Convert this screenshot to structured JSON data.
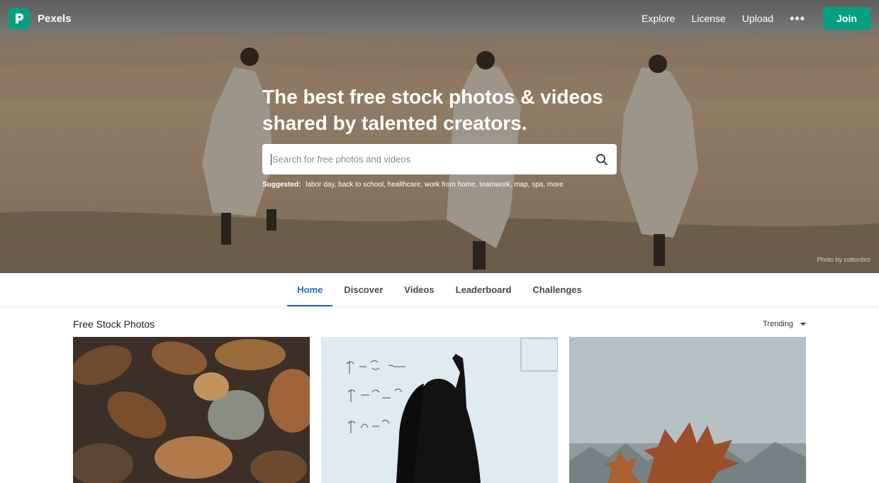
{
  "brand": {
    "name": "Pexels",
    "color": "#05a081"
  },
  "nav": {
    "explore": "Explore",
    "license": "License",
    "upload": "Upload",
    "more_icon": "ellipsis-icon",
    "join": "Join"
  },
  "hero": {
    "headline": "The best free stock photos & videos shared by talented creators.",
    "search_placeholder": "Search for free photos and videos",
    "suggested_label": "Suggested:",
    "suggestions": "labor day, back to school, healthcare, work from home, teamwork, map, spa, more",
    "credit": "Photo by cottonbro"
  },
  "tabs": [
    {
      "label": "Home",
      "active": true
    },
    {
      "label": "Discover",
      "active": false
    },
    {
      "label": "Videos",
      "active": false
    },
    {
      "label": "Leaderboard",
      "active": false
    },
    {
      "label": "Challenges",
      "active": false
    }
  ],
  "section": {
    "title": "Free Stock Photos",
    "sort": "Trending"
  },
  "accent_color": "#1f6bc1"
}
